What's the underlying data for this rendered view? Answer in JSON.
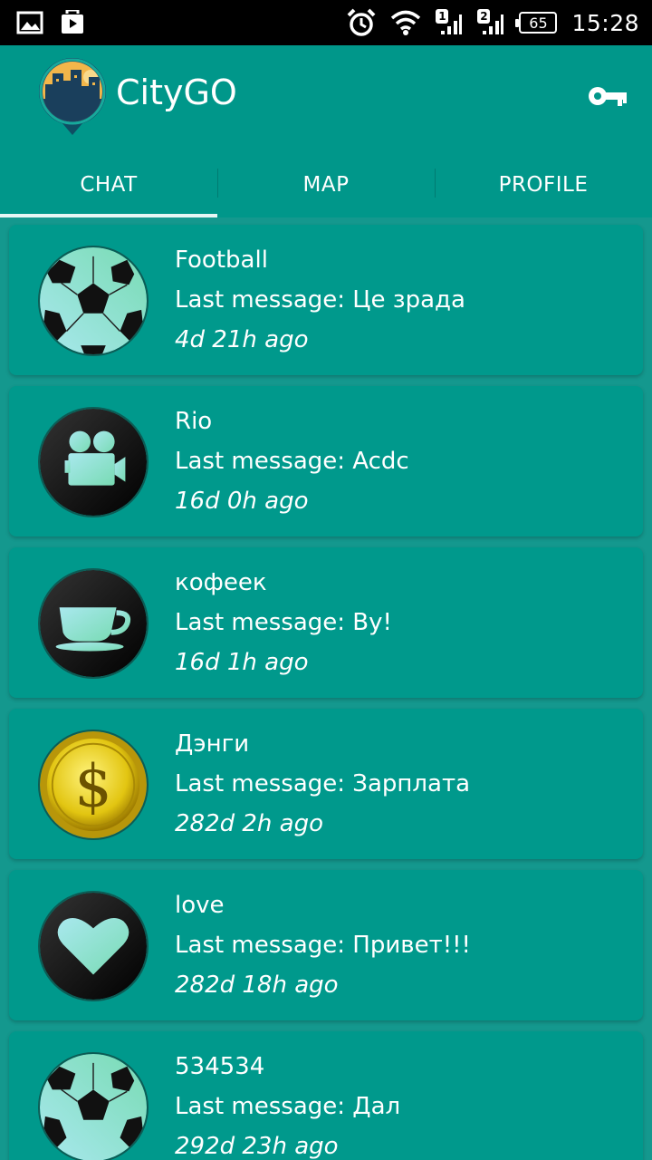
{
  "status_bar": {
    "time": "15:28",
    "battery": "65",
    "sim1": "1",
    "sim2": "2",
    "icons": [
      "image-icon",
      "play-store-icon",
      "alarm-icon",
      "wifi-icon",
      "signal-icon",
      "battery-icon"
    ]
  },
  "app": {
    "title": "CityGO",
    "logo": "city-logo-icon",
    "action_icon": "key-icon"
  },
  "tabs": [
    {
      "label": "CHAT",
      "active": true
    },
    {
      "label": "MAP",
      "active": false
    },
    {
      "label": "PROFILE",
      "active": false
    }
  ],
  "chats": [
    {
      "name": "Football",
      "last": "Last message: Це зрада",
      "time": "4d 21h ago",
      "avatar": "soccer-ball-icon"
    },
    {
      "name": "Rio",
      "last": "Last message: Acdc",
      "time": "16d 0h ago",
      "avatar": "movie-camera-icon"
    },
    {
      "name": "кофеек",
      "last": "Last message: Ву!",
      "time": "16d 1h ago",
      "avatar": "coffee-cup-icon"
    },
    {
      "name": "Дэнги",
      "last": "Last message: Зарплата",
      "time": "282d 2h ago",
      "avatar": "dollar-coin-icon"
    },
    {
      "name": "love",
      "last": "Last message: Привет!!!",
      "time": "282d 18h ago",
      "avatar": "heart-icon"
    },
    {
      "name": "534534",
      "last": "Last message: Дал",
      "time": "292d 23h ago",
      "avatar": "soccer-ball-icon"
    }
  ],
  "colors": {
    "background": "#14988e",
    "card": "#00998c",
    "app_bar": "#00978a",
    "accent_mint": "#7fe3c8"
  }
}
